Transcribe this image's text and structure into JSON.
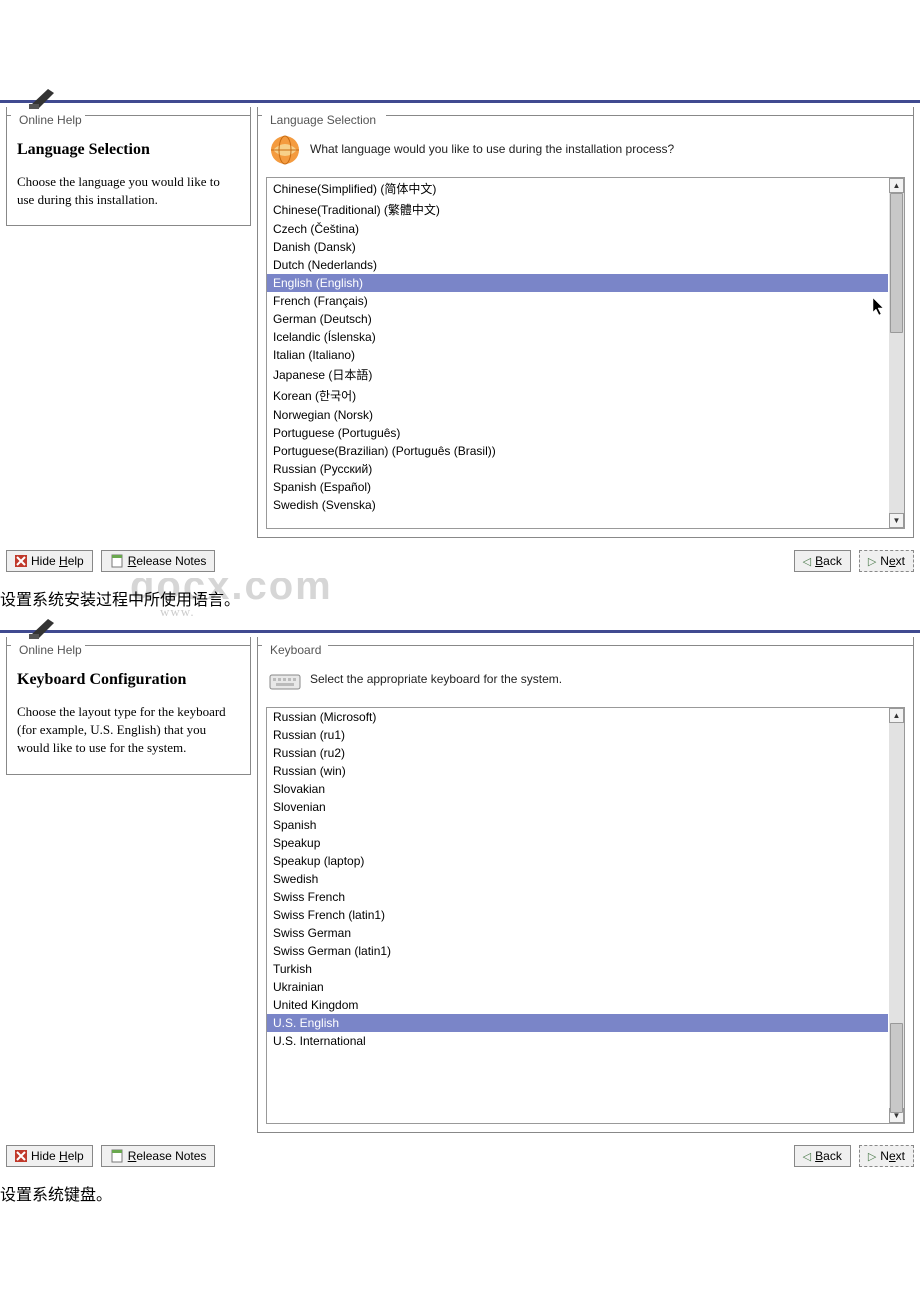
{
  "watermark_text": "docx.com",
  "watermark_sub": "www.",
  "window1": {
    "help_legend": "Online Help",
    "main_legend": "Language Selection",
    "help_title": "Language Selection",
    "help_body": "Choose the language you would like to use during this installation.",
    "prompt": "What language would you like to use during the installation process?",
    "languages": [
      "Chinese(Simplified) (简体中文)",
      "Chinese(Traditional) (繁體中文)",
      "Czech (Čeština)",
      "Danish (Dansk)",
      "Dutch (Nederlands)",
      "English (English)",
      "French (Français)",
      "German (Deutsch)",
      "Icelandic (Íslenska)",
      "Italian (Italiano)",
      "Japanese (日本語)",
      "Korean (한국어)",
      "Norwegian (Norsk)",
      "Portuguese (Português)",
      "Portuguese(Brazilian) (Português (Brasil))",
      "Russian (Русский)",
      "Spanish (Español)",
      "Swedish (Svenska)"
    ],
    "selected_index": 5,
    "buttons": {
      "hide_help_pre": "Hide ",
      "hide_help_m": "H",
      "hide_help_post": "elp",
      "release_pre": "",
      "release_m": "R",
      "release_post": "elease Notes",
      "back_pre": "",
      "back_m": "B",
      "back_post": "ack",
      "next_pre": "N",
      "next_m": "e",
      "next_post": "xt"
    },
    "caption": "设置系统安装过程中所使用语言。"
  },
  "window2": {
    "help_legend": "Online Help",
    "main_legend": "Keyboard",
    "help_title": "Keyboard Configuration",
    "help_body": "Choose the layout type for the keyboard (for example, U.S. English) that you would like to use for the system.",
    "prompt": "Select the appropriate keyboard for the system.",
    "keyboards": [
      "Russian (Microsoft)",
      "Russian (ru1)",
      "Russian (ru2)",
      "Russian (win)",
      "Slovakian",
      "Slovenian",
      "Spanish",
      "Speakup",
      "Speakup (laptop)",
      "Swedish",
      "Swiss French",
      "Swiss French (latin1)",
      "Swiss German",
      "Swiss German (latin1)",
      "Turkish",
      "Ukrainian",
      "United Kingdom",
      "U.S. English",
      "U.S. International"
    ],
    "selected_index": 17,
    "buttons": {
      "hide_help_pre": "Hide ",
      "hide_help_m": "H",
      "hide_help_post": "elp",
      "release_pre": "",
      "release_m": "R",
      "release_post": "elease Notes",
      "back_pre": "",
      "back_m": "B",
      "back_post": "ack",
      "next_pre": "N",
      "next_m": "e",
      "next_post": "xt"
    },
    "caption": "设置系统键盘。"
  }
}
